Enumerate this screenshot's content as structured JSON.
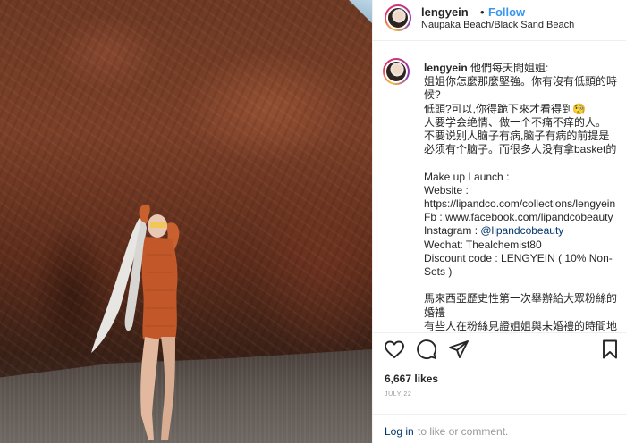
{
  "post": {
    "username": "lengyein",
    "follow_label": "Follow",
    "separator": "•",
    "location": "Naupaka Beach/Black Sand Beach"
  },
  "caption": {
    "username": "lengyein",
    "lines": [
      "他們每天問姐姐:",
      "姐姐你怎麼那麼堅強。你有沒有低頭的時",
      "候?",
      "低頭?可以,你得跪下來才看得到🧐",
      "人要学会绝情、做一个不痛不痒的人。",
      "不要说别人脑子有病,脑子有病的前提是",
      "必须有个脑子。而很多人没有拿basket的",
      "",
      "Make up Launch :",
      "Website :",
      "https://lipandco.com/collections/lengyein",
      "Fb : www.facebook.com/lipandcobeauty",
      "Instagram : ",
      "Wechat: Thealchemist80",
      "Discount code : LENGYEIN ( 10% Non-",
      "Sets )",
      "",
      "馬來西亞歷史性第一次舉辦給大眾粉絲的",
      "婚禮",
      "有些人在粉絲見證姐姐與未婚禮的時間地"
    ],
    "instagram_mention": "@lipandcobeauty"
  },
  "actions": {
    "like_icon": "heart-icon",
    "comment_icon": "comment-bubble-icon",
    "share_icon": "share-arrow-icon",
    "save_icon": "bookmark-icon"
  },
  "stats": {
    "likes": "6,667 likes",
    "date": "JULY 22"
  },
  "comment_bar": {
    "login_label": "Log in",
    "rest_text": "to like or comment."
  },
  "colors": {
    "link_blue": "#3897f0",
    "dark_link": "#003569",
    "muted": "#999999"
  }
}
